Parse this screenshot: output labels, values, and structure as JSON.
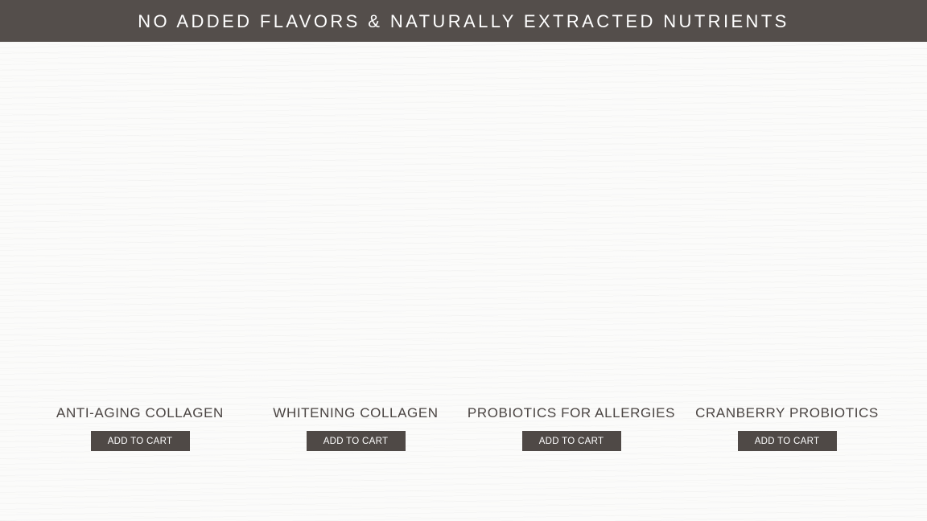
{
  "banner": {
    "text": "NO ADDED FLAVORS & NATURALLY EXTRACTED NUTRIENTS"
  },
  "products": [
    {
      "title": "ANTI-AGING COLLAGEN",
      "button_label": "ADD TO CART"
    },
    {
      "title": "WHITENING COLLAGEN",
      "button_label": "ADD TO CART"
    },
    {
      "title": "PROBIOTICS FOR ALLERGIES",
      "button_label": "ADD TO CART"
    },
    {
      "title": "CRANBERRY PROBIOTICS",
      "button_label": "ADD TO CART"
    }
  ],
  "colors": {
    "banner_background": "#544e4b",
    "button_background": "#4f4946",
    "page_background": "#fbfbfa",
    "title_text": "#4a4442"
  }
}
